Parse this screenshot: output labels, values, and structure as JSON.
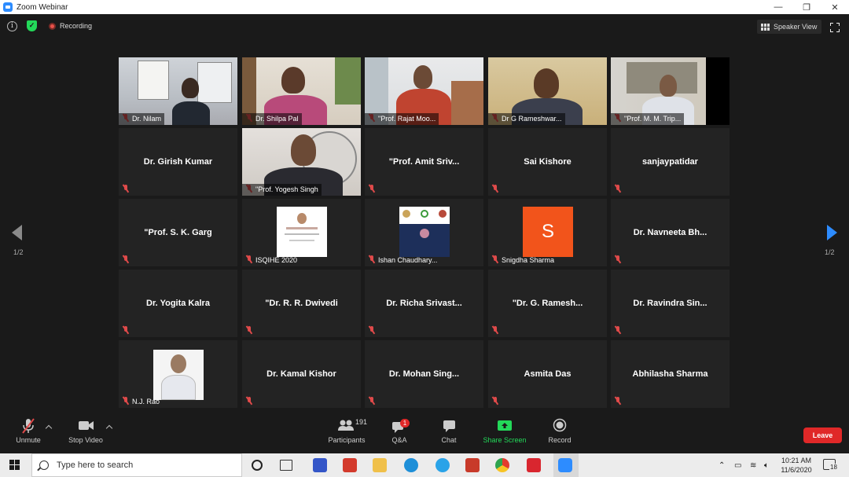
{
  "window": {
    "title": "Zoom Webinar",
    "minimize_glyph": "—",
    "restore_glyph": "❐",
    "close_glyph": "✕"
  },
  "topbar": {
    "info_glyph": "i",
    "shield_glyph": "✓",
    "recording_label": "Recording",
    "speaker_view_label": "Speaker View"
  },
  "grid": {
    "tiles": [
      {
        "name": "Dr. Nilam",
        "video": true
      },
      {
        "name": "Dr. Shilpa Pal",
        "video": true
      },
      {
        "name": "\"Prof. Rajat Moo...",
        "video": true
      },
      {
        "name": "Dr G Rameshwar...",
        "video": true
      },
      {
        "name": "\"Prof. M. M. Trip...",
        "video": true
      },
      {
        "name": "Dr. Girish Kumar",
        "video": false
      },
      {
        "name": "\"Prof. Yogesh Singh",
        "video": true,
        "active": true
      },
      {
        "name": "\"Prof. Amit Sriv...",
        "video": false
      },
      {
        "name": "Sai Kishore",
        "video": false
      },
      {
        "name": "sanjaypatidar",
        "video": false
      },
      {
        "name": "\"Prof. S. K. Garg",
        "video": false
      },
      {
        "name": "ISQIHE 2020",
        "video": "image"
      },
      {
        "name": "Ishan Chaudhary...",
        "video": "image"
      },
      {
        "name": "Snigdha Sharma",
        "video": "avatar",
        "avatar_letter": "S"
      },
      {
        "name": "Dr. Navneeta Bh...",
        "video": false
      },
      {
        "name": "Dr. Yogita Kalra",
        "video": false
      },
      {
        "name": "\"Dr. R. R. Dwivedi",
        "video": false
      },
      {
        "name": "Dr. Richa Srivast...",
        "video": false
      },
      {
        "name": "\"Dr. G. Ramesh...",
        "video": false
      },
      {
        "name": "Dr. Ravindra Sin...",
        "video": false
      },
      {
        "name": "N.J. Rao",
        "video": "image"
      },
      {
        "name": "Dr. Kamal Kishor",
        "video": false
      },
      {
        "name": "Dr. Mohan Sing...",
        "video": false
      },
      {
        "name": "Asmita Das",
        "video": false
      },
      {
        "name": "Abhilasha Sharma",
        "video": false
      }
    ]
  },
  "pagination": {
    "left_label": "1/2",
    "right_label": "1/2"
  },
  "toolbar": {
    "unmute_label": "Unmute",
    "stop_video_label": "Stop Video",
    "participants_label": "Participants",
    "participants_count": "191",
    "qa_label": "Q&A",
    "qa_badge": "1",
    "chat_label": "Chat",
    "share_screen_label": "Share Screen",
    "record_label": "Record",
    "leave_label": "Leave"
  },
  "taskbar": {
    "search_placeholder": "Type here to search",
    "time": "10:21 AM",
    "date": "11/6/2020",
    "notification_count": "18"
  },
  "colors": {
    "accent_blue": "#2d8cff",
    "active_speaker": "#ccec5a",
    "leave_red": "#e02828",
    "share_green": "#23d959",
    "avatar_orange": "#f2541b"
  }
}
